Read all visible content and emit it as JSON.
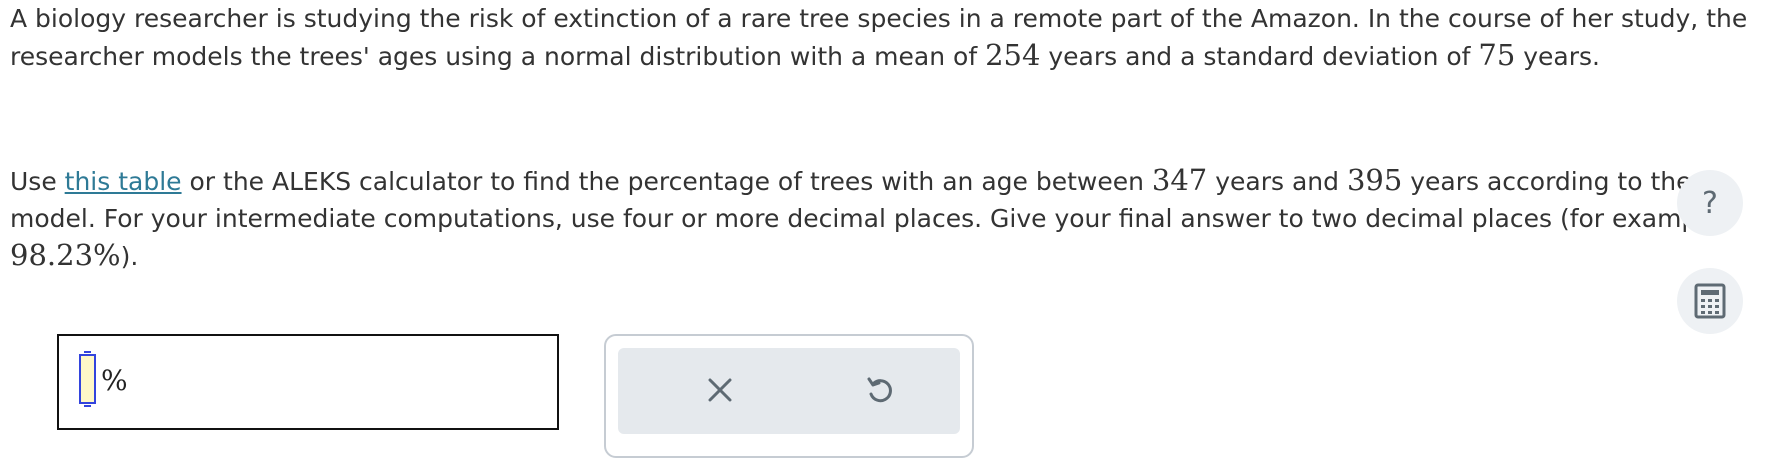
{
  "problem": {
    "p1_a": "A biology researcher is studying the risk of extinction of a rare tree species in a remote part of the Amazon. In the course of her study, the researcher models the trees' ages using a normal distribution with a mean of ",
    "mean": "254",
    "p1_b": " years and a standard deviation of ",
    "sd": "75",
    "p1_c": " years.",
    "p2_a": "Use ",
    "link": "this table",
    "p2_b": " or the ALEKS calculator to find the percentage of trees with an age between ",
    "lower": "347",
    "p2_c": " years and ",
    "upper": "395",
    "p2_d": " years according to the model. For your intermediate computations, use four or more decimal places. Give your final answer to two decimal places (for example ",
    "example": "98.23%",
    "p2_e": ")."
  },
  "answer": {
    "value": "",
    "unit": "%"
  },
  "side_buttons": {
    "help_glyph": "?",
    "help_icon": "help-icon",
    "calculator_icon": "calculator-icon"
  },
  "toolbar": {
    "clear_icon": "close-icon",
    "undo_icon": "undo-icon"
  }
}
